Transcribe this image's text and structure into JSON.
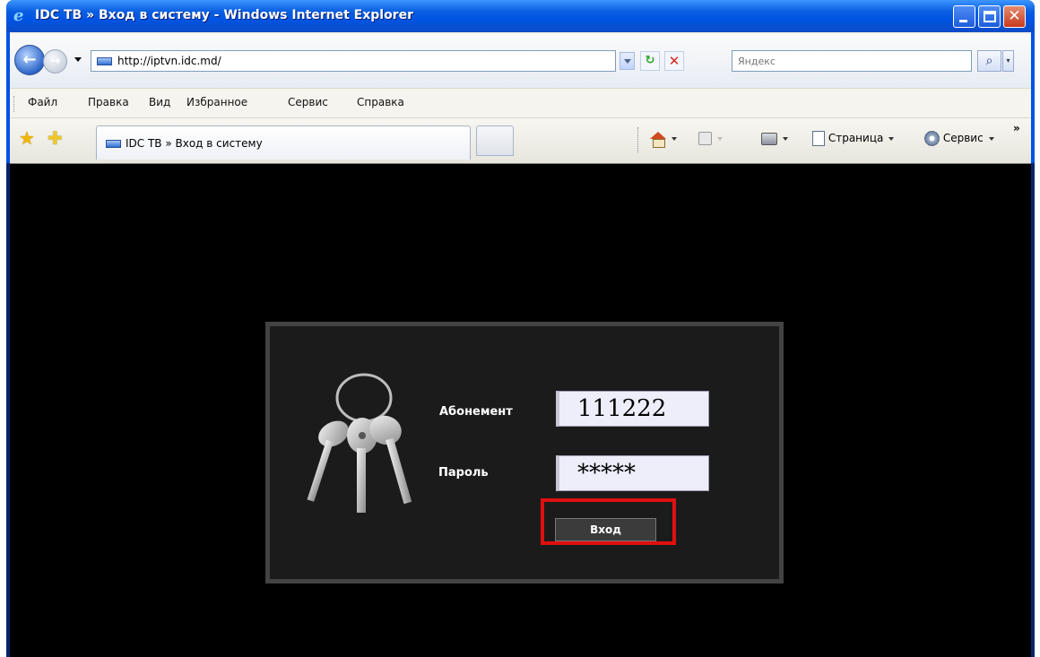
{
  "window": {
    "title": "IDC ТВ » Вход в систему - Windows Internet Explorer",
    "close_glyph": "✕"
  },
  "address_bar": {
    "back_glyph": "←",
    "forward_glyph": "→",
    "url": "http://iptvn.idc.md/",
    "refresh_glyph": "↻",
    "stop_glyph": "✕",
    "search_placeholder": "Яндекс",
    "search_go_glyph": "⌕",
    "search_dropdown_glyph": "▾"
  },
  "menu": {
    "items": [
      "Файл",
      "Правка",
      "Вид",
      "Избранное",
      "Сервис",
      "Справка"
    ]
  },
  "tabs": {
    "active_tab_label": "IDC ТВ » Вход в систему"
  },
  "command_bar": {
    "page_label": "Страница",
    "tools_label": "Сервис",
    "chevron": "»"
  },
  "login": {
    "subscriber_label": "Абонемент",
    "subscriber_value": "111222",
    "password_label": "Пароль",
    "password_value": "*****",
    "submit_label": "Вход"
  },
  "colors": {
    "titlebar": "#0054e3",
    "page_background": "#000000",
    "panel_background": "#1b1b1b",
    "panel_border": "#434343",
    "highlight": "#e01010"
  },
  "icons": [
    "ie-icon",
    "back-icon",
    "forward-icon",
    "page-icon",
    "refresh-icon",
    "stop-icon",
    "search-icon",
    "favorites-star-icon",
    "add-favorite-icon",
    "home-icon",
    "feed-icon",
    "print-icon",
    "page-menu-icon",
    "gear-icon",
    "keys-icon"
  ]
}
